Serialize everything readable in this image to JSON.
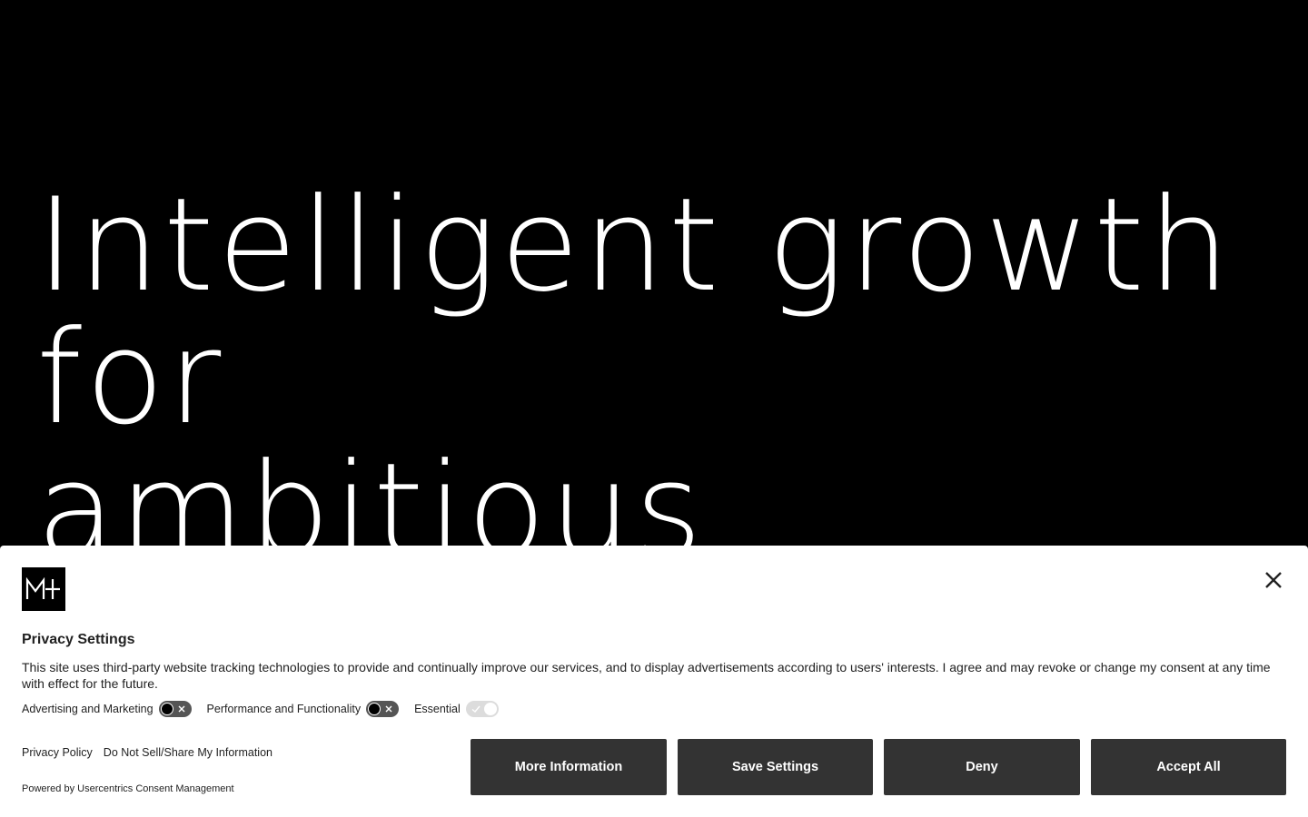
{
  "hero": {
    "lines": [
      "Intelligent growth",
      "for",
      "ambitious"
    ]
  },
  "consent": {
    "logo_text": "M+",
    "title": "Privacy Settings",
    "description": "This site uses third-party website tracking technologies to provide and continually improve our services, and to display advertisements according to users' interests. I agree and may revoke or change my consent at any time with effect for the future.",
    "toggles": [
      {
        "label": "Advertising and Marketing",
        "state": "off"
      },
      {
        "label": "Performance and Functionality",
        "state": "off"
      },
      {
        "label": "Essential",
        "state": "on-disabled"
      }
    ],
    "links": {
      "privacy_policy": "Privacy Policy",
      "do_not_sell": "Do Not Sell/Share My Information"
    },
    "powered_by": "Powered by Usercentrics Consent Management",
    "buttons": {
      "more_information": "More Information",
      "save_settings": "Save Settings",
      "deny": "Deny",
      "accept_all": "Accept All"
    },
    "close_icon": "close-icon"
  },
  "colors": {
    "hero_background": "#000000",
    "hero_text": "#ffffff",
    "banner_background": "#ffffff",
    "button_background": "#333333",
    "button_text": "#ffffff"
  }
}
